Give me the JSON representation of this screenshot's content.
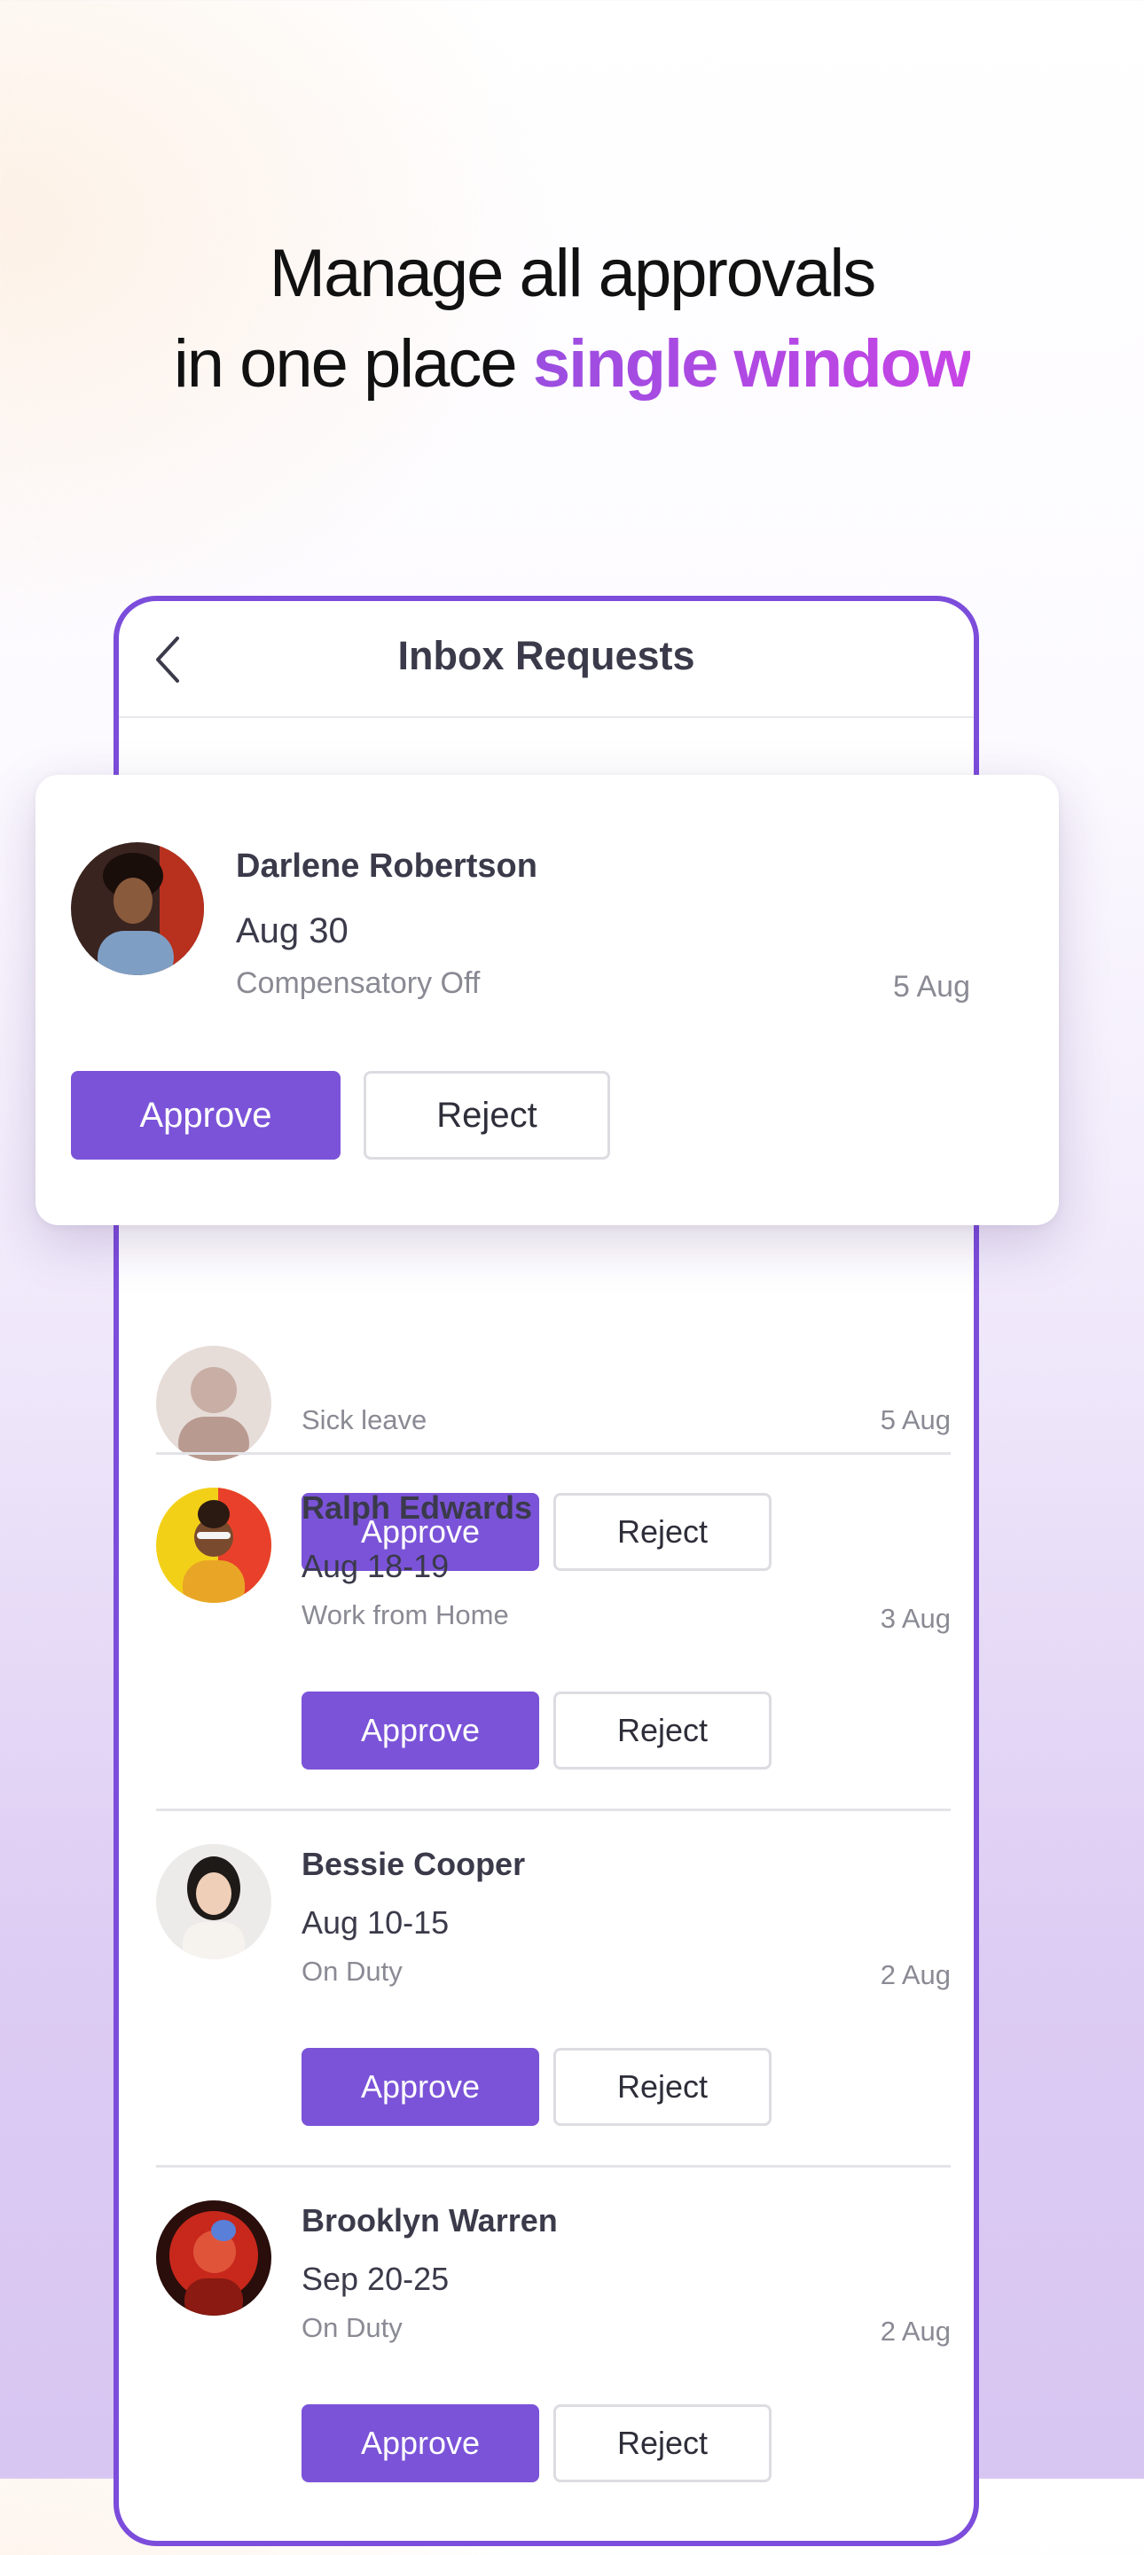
{
  "headline": {
    "line1": "Manage all approvals",
    "line2_prefix": "in one place ",
    "line2_accent": "single window"
  },
  "screen": {
    "title": "Inbox Requests",
    "back_icon": "chevron-left-icon"
  },
  "featured_request": {
    "name": "Darlene Robertson",
    "dates": "Aug 30",
    "type": "Compensatory Off",
    "sent": "5 Aug",
    "approve_label": "Approve",
    "reject_label": "Reject"
  },
  "requests": [
    {
      "name": "",
      "dates": "",
      "type": "Sick leave",
      "sent": "5 Aug",
      "approve_label": "Approve",
      "reject_label": "Reject"
    },
    {
      "name": "Ralph Edwards",
      "dates": "Aug 18-19",
      "type": "Work from Home",
      "sent": "3 Aug",
      "approve_label": "Approve",
      "reject_label": "Reject"
    },
    {
      "name": "Bessie Cooper",
      "dates": "Aug 10-15",
      "type": "On Duty",
      "sent": "2 Aug",
      "approve_label": "Approve",
      "reject_label": "Reject"
    },
    {
      "name": "Brooklyn Warren",
      "dates": "Sep 20-25",
      "type": "On Duty",
      "sent": "2 Aug",
      "approve_label": "Approve",
      "reject_label": "Reject"
    }
  ],
  "colors": {
    "accent": "#7b53d8",
    "frame": "#7c4ddb",
    "headline_gradient_start": "#9a4ee0",
    "headline_gradient_end": "#c744e6"
  }
}
